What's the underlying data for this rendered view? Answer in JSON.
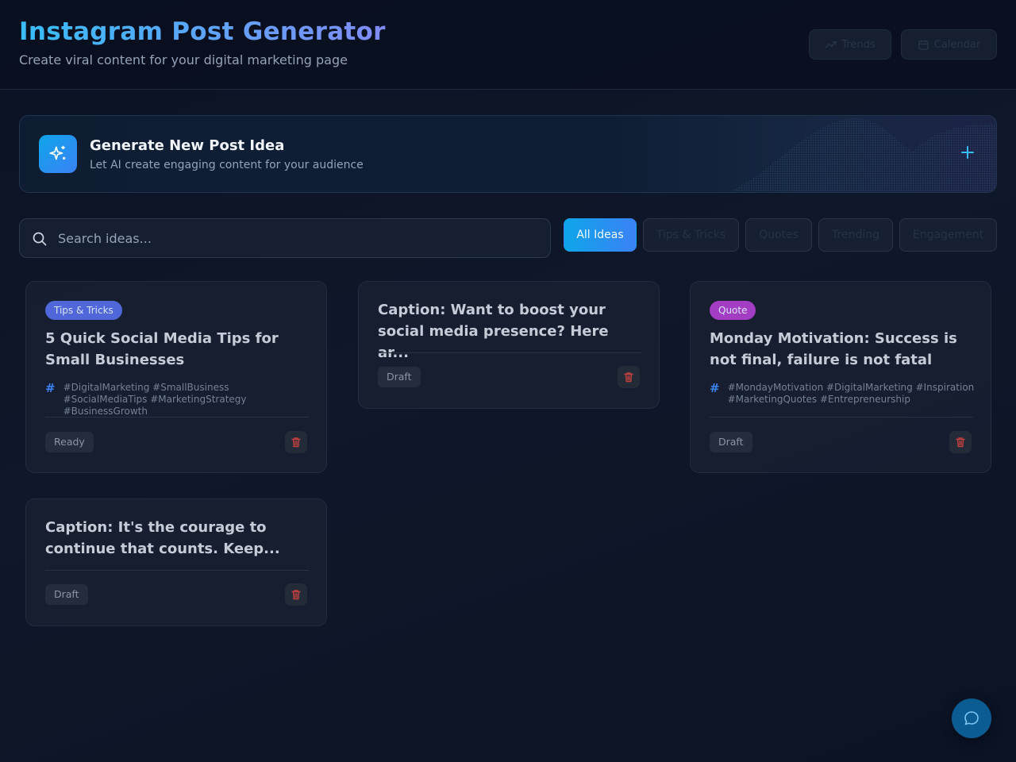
{
  "header": {
    "title": "Instagram Post Generator",
    "subtitle": "Create viral content for your digital marketing page",
    "trends_label": "Trends",
    "calendar_label": "Calendar"
  },
  "generate": {
    "title": "Generate New Post Idea",
    "subtitle": "Let AI create engaging content for your audience"
  },
  "search": {
    "placeholder": "Search ideas..."
  },
  "filters": [
    "All Ideas",
    "Tips & Tricks",
    "Quotes",
    "Trending",
    "Engagement"
  ],
  "active_filter": "All Ideas",
  "cards": [
    {
      "tag": "Tips & Tricks",
      "title": "5 Quick Social Media Tips for Small Businesses",
      "hashtags": "#DigitalMarketing #SmallBusiness #SocialMediaTips #MarketingStrategy #BusinessGrowth",
      "status": "Ready"
    },
    {
      "title": "Caption: Want to boost your social media presence? Here ar...",
      "status": "Draft"
    },
    {
      "tag": "Quote",
      "title": "Monday Motivation: Success is not final, failure is not fatal",
      "hashtags": "#MondayMotivation #DigitalMarketing #Inspiration #MarketingQuotes #Entrepreneurship",
      "status": "Draft"
    },
    {
      "title": "Caption: It's the courage to continue that counts. Keep...",
      "status": "Draft"
    }
  ],
  "colors": {
    "accent": "#0ea5e9",
    "tag_tips": "#4f67d8",
    "tag_quote": "#a23dc4",
    "delete": "#dc2626"
  },
  "icons": {
    "generate": "sparkles-icon",
    "search": "search-icon",
    "delete": "trash-icon",
    "chat": "chat-bubble-icon",
    "hashtags": "hash-icon"
  }
}
